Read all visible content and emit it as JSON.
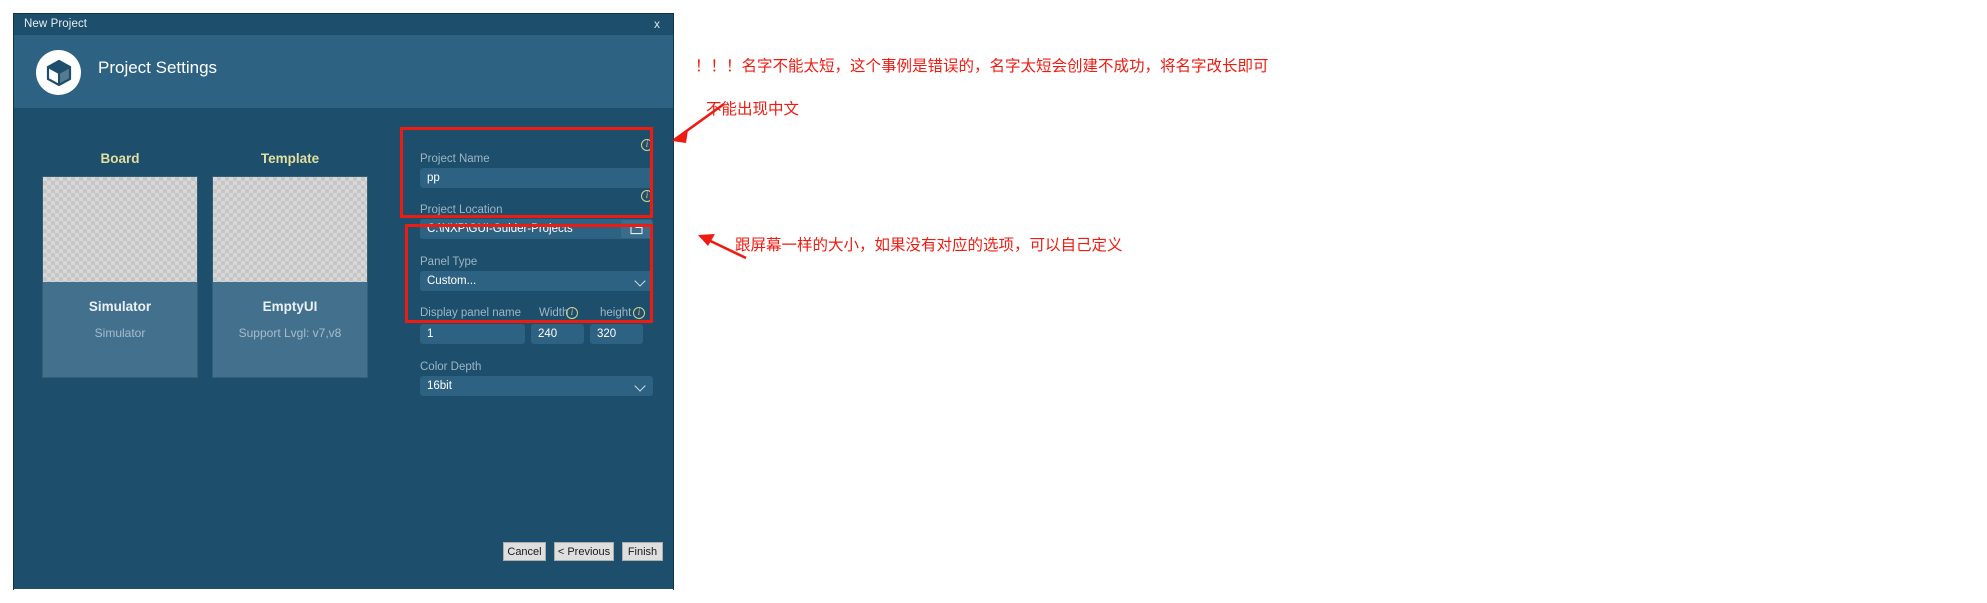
{
  "window": {
    "title": "New Project",
    "close_label": "x",
    "header_title": "Project Settings",
    "logo_icon": "cube-icon"
  },
  "columns": {
    "board_label": "Board",
    "template_label": "Template"
  },
  "cards": [
    {
      "title": "Simulator",
      "subtitle": "Simulator",
      "thumb": "checkerboard-transparent"
    },
    {
      "title": "EmptyUI",
      "subtitle": "Support Lvgl: v7,v8",
      "thumb": "checkerboard-transparent"
    }
  ],
  "form": {
    "project_name": {
      "label": "Project Name",
      "value": "pp",
      "info_icon": "info-icon"
    },
    "project_location": {
      "label": "Project Location",
      "value": "C:\\NXP\\GUI-Guider-Projects",
      "info_icon": "info-icon",
      "browse_icon": "folder-icon"
    },
    "panel_type": {
      "label": "Panel Type",
      "value": "Custom...",
      "chevron_icon": "chevron-down-icon"
    },
    "display_panel_name": {
      "label": "Display panel name",
      "value": "1"
    },
    "width": {
      "label": "Width",
      "value": "240",
      "info_icon": "info-icon"
    },
    "height": {
      "label": "height",
      "value": "320",
      "info_icon": "info-icon"
    },
    "color_depth": {
      "label": "Color Depth",
      "value": "16bit",
      "chevron_icon": "chevron-down-icon"
    }
  },
  "footer": {
    "cancel": "Cancel",
    "previous": "< Previous",
    "finish": "Finish"
  },
  "annotations": {
    "color": "#ee1b11",
    "line1": "！！！名字不能太短，这个事例是错误的，名字太短会创建不成功，将名字改长即可",
    "line2": "不能出现中文",
    "line3": "跟屏幕一样的大小，如果没有对应的选项，可以自己定义"
  }
}
